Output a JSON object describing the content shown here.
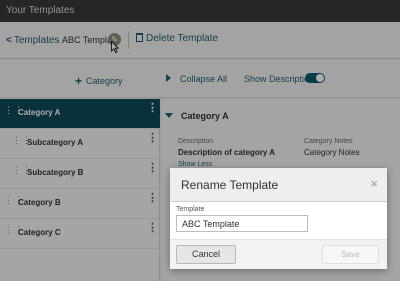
{
  "window": {
    "title": "Your Templates"
  },
  "toolbar": {
    "back_label": "Templates",
    "back_icon": "chevron-left-icon",
    "template_name": "ABC Template",
    "edit_icon": "pencil-icon",
    "delete_label": "Delete Template",
    "delete_icon": "trash-icon"
  },
  "subbar": {
    "add_category_label": "Category",
    "collapse_label": "Collapse All",
    "show_description_label": "Show Description",
    "show_description_on": true
  },
  "categories": [
    {
      "label": "Category A",
      "level": 0,
      "active": true
    },
    {
      "label": "Subcategory A",
      "level": 1,
      "active": false
    },
    {
      "label": "Subcategory B",
      "level": 1,
      "active": false
    },
    {
      "label": "Category B",
      "level": 0,
      "active": false
    },
    {
      "label": "Category C",
      "level": 0,
      "active": false
    }
  ],
  "detail": {
    "heading": "Category A",
    "description_label": "Description",
    "description_value": "Description of category A",
    "show_less": "Show Less",
    "notes_label": "Category Notes",
    "notes_value": "Category Notes"
  },
  "modal": {
    "title": "Rename Template",
    "close_glyph": "×",
    "field_label": "Template",
    "field_value": "ABC Template",
    "cancel_label": "Cancel",
    "save_label": "Save"
  },
  "colors": {
    "accent": "#1d5f6f",
    "active_row": "#0c4a5a",
    "titlebar": "#3a3a3a"
  }
}
